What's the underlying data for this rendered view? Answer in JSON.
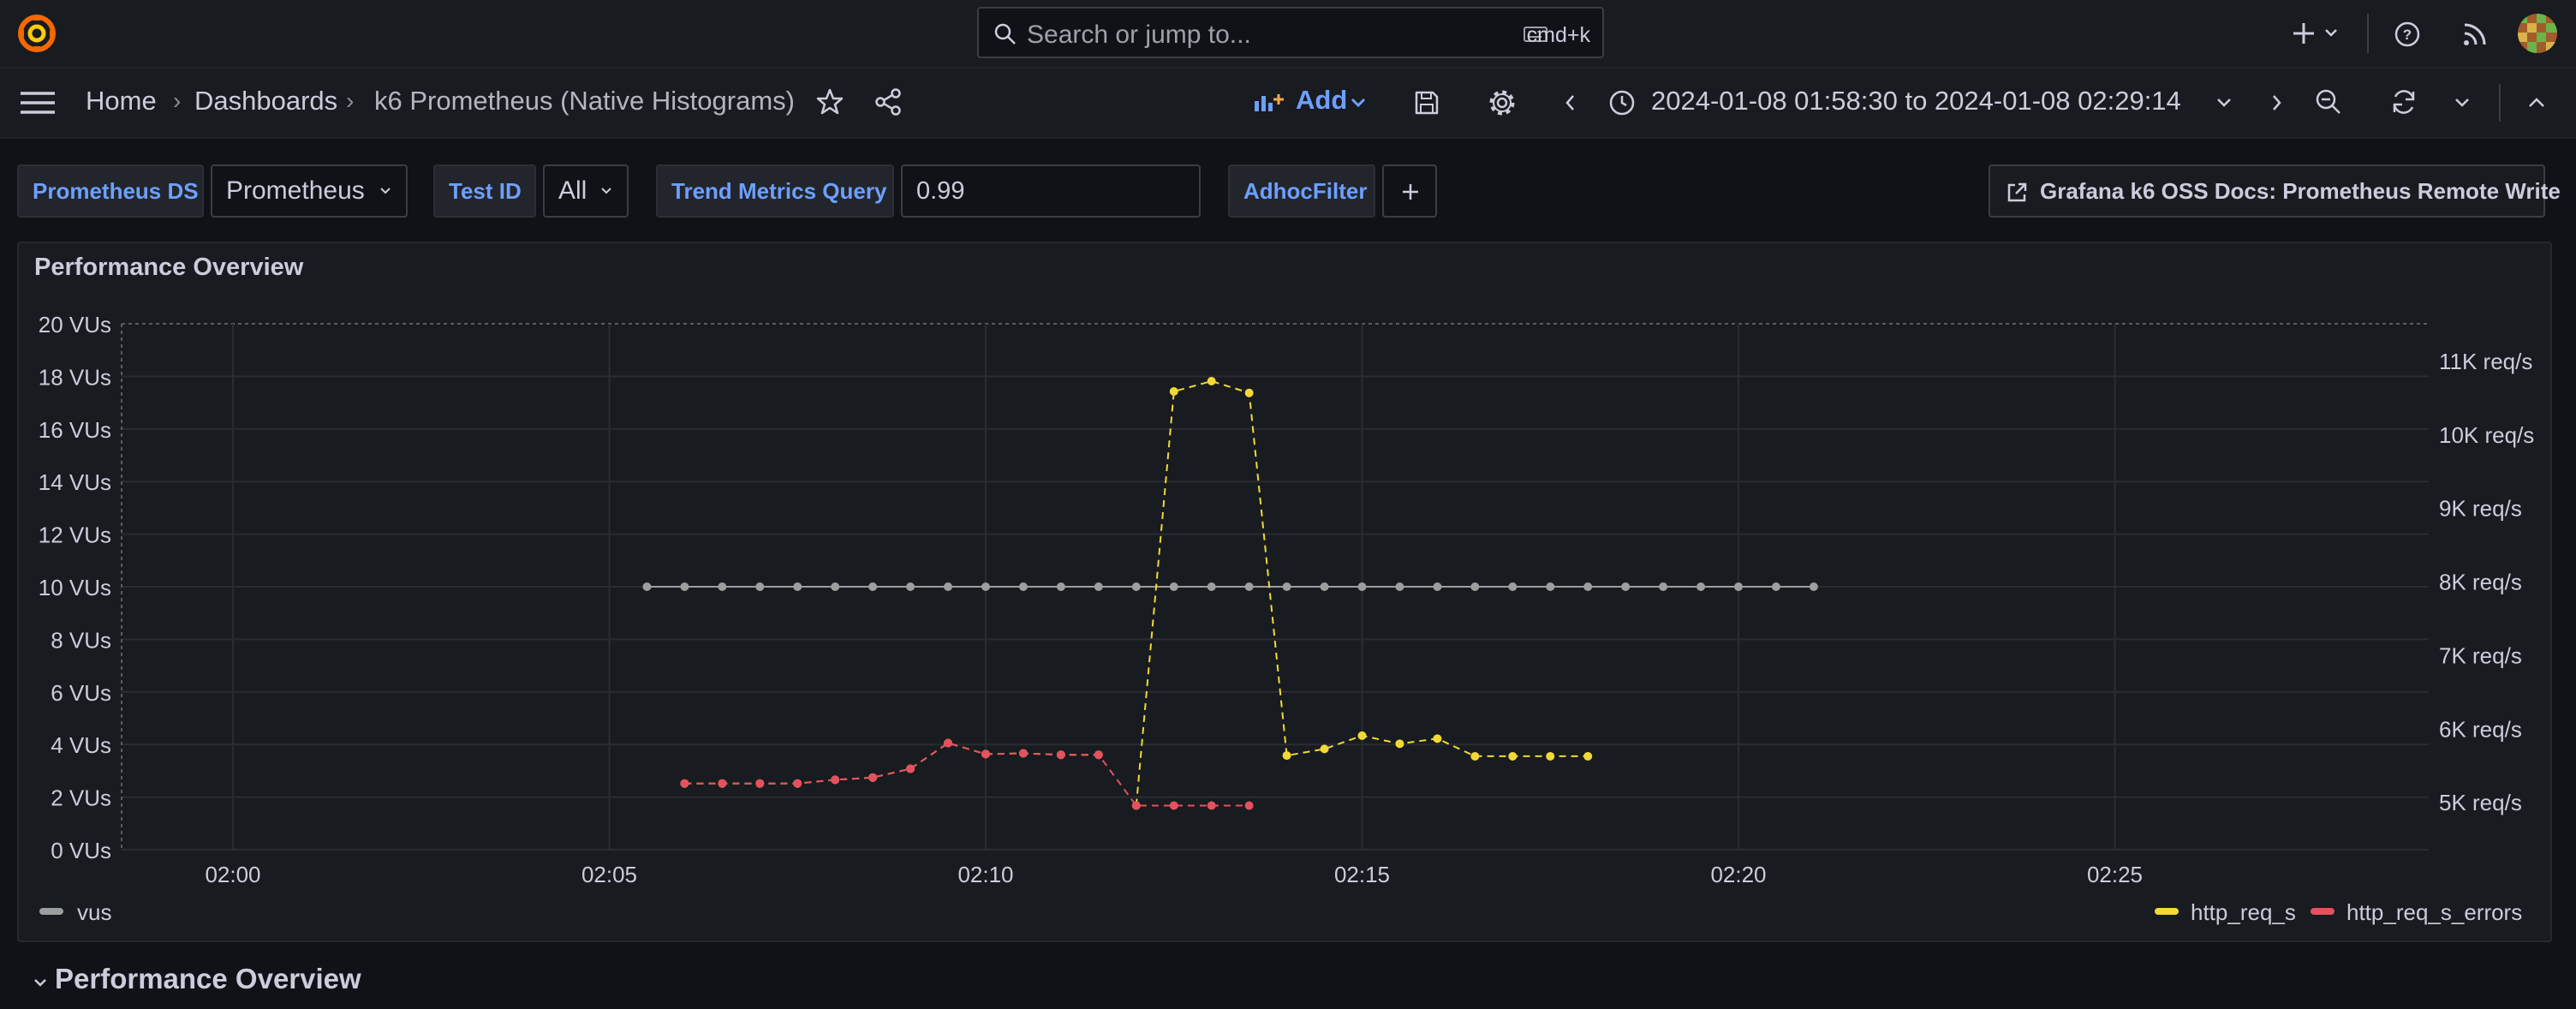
{
  "topbar": {
    "search_placeholder": "Search or jump to...",
    "shortcut": "cmd+k"
  },
  "navbar": {
    "breadcrumbs": [
      "Home",
      "Dashboards",
      "k6 Prometheus (Native Histograms)"
    ],
    "add_label": "Add",
    "time_range": "2024-01-08 01:58:30 to 2024-01-08 02:29:14"
  },
  "variables": {
    "datasource_label": "Prometheus DS",
    "datasource_value": "Prometheus",
    "testid_label": "Test ID",
    "testid_value": "All",
    "trend_label": "Trend Metrics Query",
    "trend_value": "0.99",
    "adhoc_label": "AdhocFilter",
    "docs_link": "Grafana k6 OSS Docs: Prometheus Remote Write"
  },
  "panel": {
    "title": "Performance Overview"
  },
  "row": {
    "title": "Performance Overview"
  },
  "colors": {
    "background": "#111217",
    "panel": "#181b1f",
    "accent": "#6e9fff",
    "vus": "#9e9e9e",
    "http_req_s": "#f2d934",
    "http_req_s_errors": "#e4515f"
  },
  "chart_data": {
    "type": "line",
    "xlabel": "",
    "x_ticks": [
      "02:00",
      "02:05",
      "02:10",
      "02:15",
      "02:20",
      "02:25"
    ],
    "left_axis": {
      "ylabel": "",
      "ylim": [
        0,
        20
      ],
      "ticks": [
        "0 VUs",
        "2 VUs",
        "4 VUs",
        "6 VUs",
        "8 VUs",
        "10 VUs",
        "12 VUs",
        "14 VUs",
        "16 VUs",
        "18 VUs",
        "20 VUs"
      ]
    },
    "right_axis": {
      "ylabel": "",
      "ylim": [
        4350,
        11500
      ],
      "ticks": [
        "5K req/s",
        "6K req/s",
        "7K req/s",
        "8K req/s",
        "9K req/s",
        "10K req/s",
        "11K req/s"
      ]
    },
    "grid": true,
    "legend": {
      "left": [
        "vus"
      ],
      "right": [
        "http_req_s",
        "http_req_s_errors"
      ],
      "placement": "bottom"
    },
    "series": [
      {
        "name": "vus",
        "axis": "left",
        "style": "solid",
        "x": [
          "02:05:30",
          "02:06",
          "02:06:30",
          "02:07",
          "02:07:30",
          "02:08",
          "02:08:30",
          "02:09",
          "02:09:30",
          "02:10",
          "02:10:30",
          "02:11",
          "02:11:30",
          "02:12",
          "02:12:30",
          "02:13",
          "02:13:30",
          "02:14",
          "02:14:30",
          "02:15",
          "02:15:30",
          "02:16",
          "02:16:30",
          "02:17",
          "02:17:30",
          "02:18",
          "02:18:30",
          "02:19",
          "02:19:30",
          "02:20",
          "02:20:30",
          "02:21"
        ],
        "values": [
          10,
          10,
          10,
          10,
          10,
          10,
          10,
          10,
          10,
          10,
          10,
          10,
          10,
          10,
          10,
          10,
          10,
          10,
          10,
          10,
          10,
          10,
          10,
          10,
          10,
          10,
          10,
          10,
          10,
          10,
          10,
          10
        ]
      },
      {
        "name": "http_req_s",
        "axis": "right",
        "style": "dashed",
        "x": [
          "02:06",
          "02:06:30",
          "02:07",
          "02:07:30",
          "02:08",
          "02:08:30",
          "02:09",
          "02:09:30",
          "02:10",
          "02:10:30",
          "02:11",
          "02:11:30",
          "02:12",
          "02:12:30",
          "02:13",
          "02:13:30",
          "02:14",
          "02:14:30",
          "02:15",
          "02:15:30",
          "02:16",
          "02:16:30",
          "02:17",
          "02:17:30",
          "02:18"
        ],
        "values": [
          5250,
          5250,
          5250,
          5250,
          5300,
          5330,
          5450,
          5800,
          5650,
          5660,
          5640,
          5640,
          4950,
          10580,
          10720,
          10560,
          5630,
          5720,
          5900,
          5790,
          5860,
          5620,
          5620,
          5620,
          5620
        ],
        "segments": [
          [
            0,
            11
          ],
          [
            12,
            24
          ]
        ]
      },
      {
        "name": "http_req_s_errors",
        "axis": "right",
        "style": "dashed",
        "x": [
          "02:06",
          "02:06:30",
          "02:07",
          "02:07:30",
          "02:08",
          "02:08:30",
          "02:09",
          "02:09:30",
          "02:10",
          "02:10:30",
          "02:11",
          "02:11:30",
          "02:12",
          "02:12:30",
          "02:13",
          "02:13:30"
        ],
        "values": [
          5250,
          5250,
          5250,
          5250,
          5300,
          5330,
          5450,
          5800,
          5650,
          5660,
          5640,
          5640,
          4950,
          4950,
          4950,
          4950
        ]
      }
    ]
  }
}
